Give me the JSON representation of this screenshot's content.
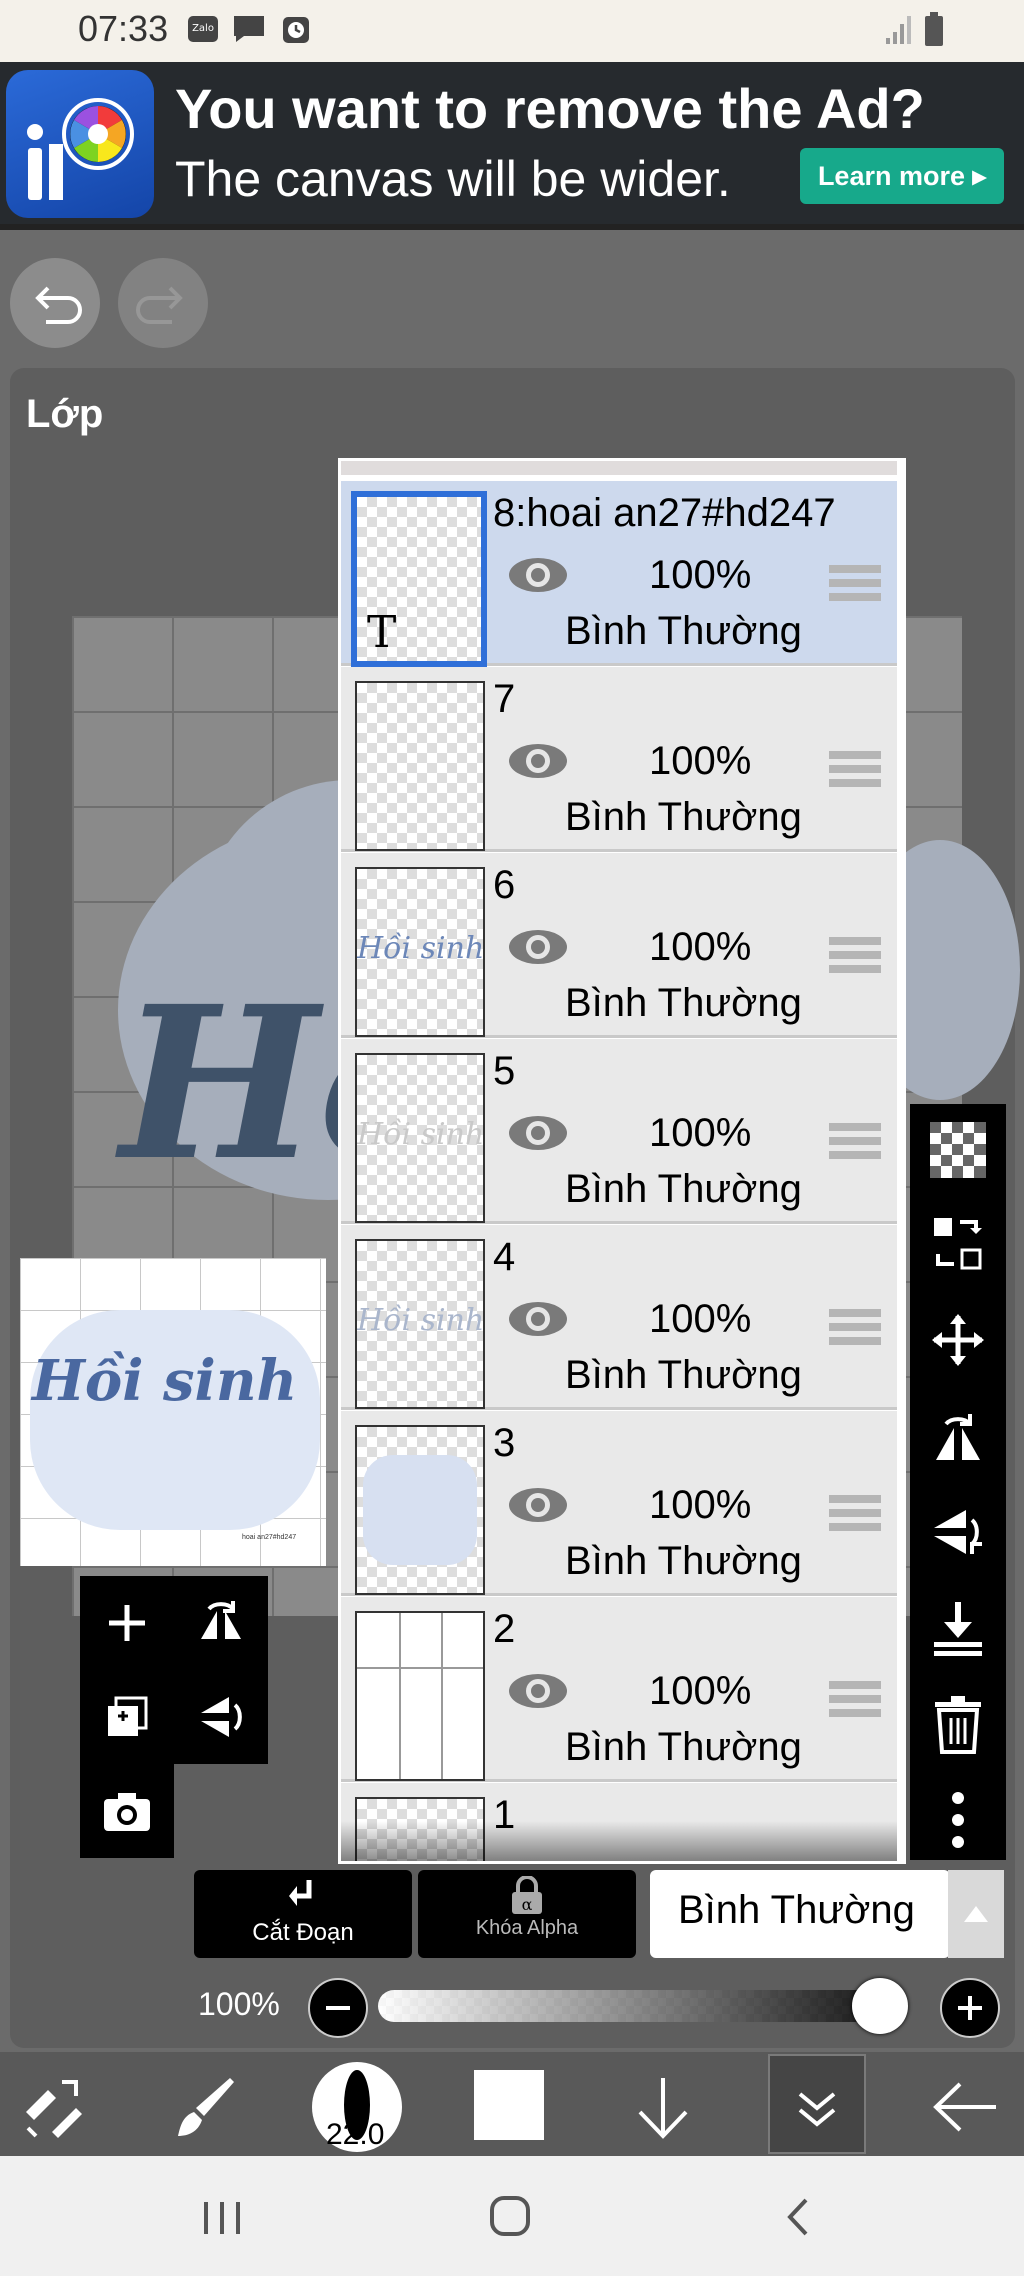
{
  "status_bar": {
    "time": "07:33",
    "notification_icons": [
      "zalo-icon",
      "message-icon",
      "clock-icon"
    ],
    "zalo_label": "Zalo",
    "system_icons": [
      "signal-icon",
      "battery-icon"
    ]
  },
  "ad": {
    "logo_text": "iP",
    "headline": "You want to remove the Ad?",
    "subline": "The canvas will be wider.",
    "cta": "Learn more ▸",
    "accent": "#17a98b"
  },
  "nav": {
    "undo_icon": "undo-icon",
    "redo_icon": "redo-icon"
  },
  "panel": {
    "title": "Lớp"
  },
  "layers": [
    {
      "name": "8:hoai an27#hd247",
      "opacity": "100%",
      "blend": "Bình Thường",
      "selected": true,
      "thumb_glyph": "T"
    },
    {
      "name": "7",
      "opacity": "100%",
      "blend": "Bình Thường",
      "selected": false
    },
    {
      "name": "6",
      "opacity": "100%",
      "blend": "Bình Thường",
      "selected": false,
      "thumb_text": "Hồi sinh"
    },
    {
      "name": "5",
      "opacity": "100%",
      "blend": "Bình Thường",
      "selected": false,
      "thumb_text": "Hồi sinh"
    },
    {
      "name": "4",
      "opacity": "100%",
      "blend": "Bình Thường",
      "selected": false,
      "thumb_text": "Hồi sinh"
    },
    {
      "name": "3",
      "opacity": "100%",
      "blend": "Bình Thường",
      "selected": false
    },
    {
      "name": "2",
      "opacity": "100%",
      "blend": "Bình Thường",
      "selected": false
    },
    {
      "name": "1"
    }
  ],
  "preview": {
    "text": "Hồi sinh",
    "signature": "hoai an27#hd247"
  },
  "canvas": {
    "text": "Hồ"
  },
  "right_toolbar": [
    "transparency-icon",
    "layer-convert-icon",
    "move-icon",
    "flip-horizontal-icon",
    "flip-vertical-icon",
    "merge-down-icon",
    "trash-icon",
    "more-icon"
  ],
  "left_tools": [
    "add-layer-icon",
    "flip-layer-icon",
    "duplicate-layer-icon",
    "flip-vertical-layer-icon",
    "camera-icon"
  ],
  "controls": {
    "clip_label": "Cắt Đoạn",
    "alpha_lock_label": "Khóa Alpha",
    "blend_mode": "Bình Thường",
    "opacity_label": "100%",
    "opacity_value": 1.0
  },
  "bottom_toolbar": {
    "brush_size": "22.0",
    "tools": [
      "transform-icon",
      "brush-icon",
      "brush-size-icon",
      "color-swatch",
      "down-arrow-icon",
      "layer-menu-icon",
      "back-arrow-icon"
    ]
  },
  "system_nav": [
    "recents-icon",
    "home-icon",
    "back-icon"
  ]
}
